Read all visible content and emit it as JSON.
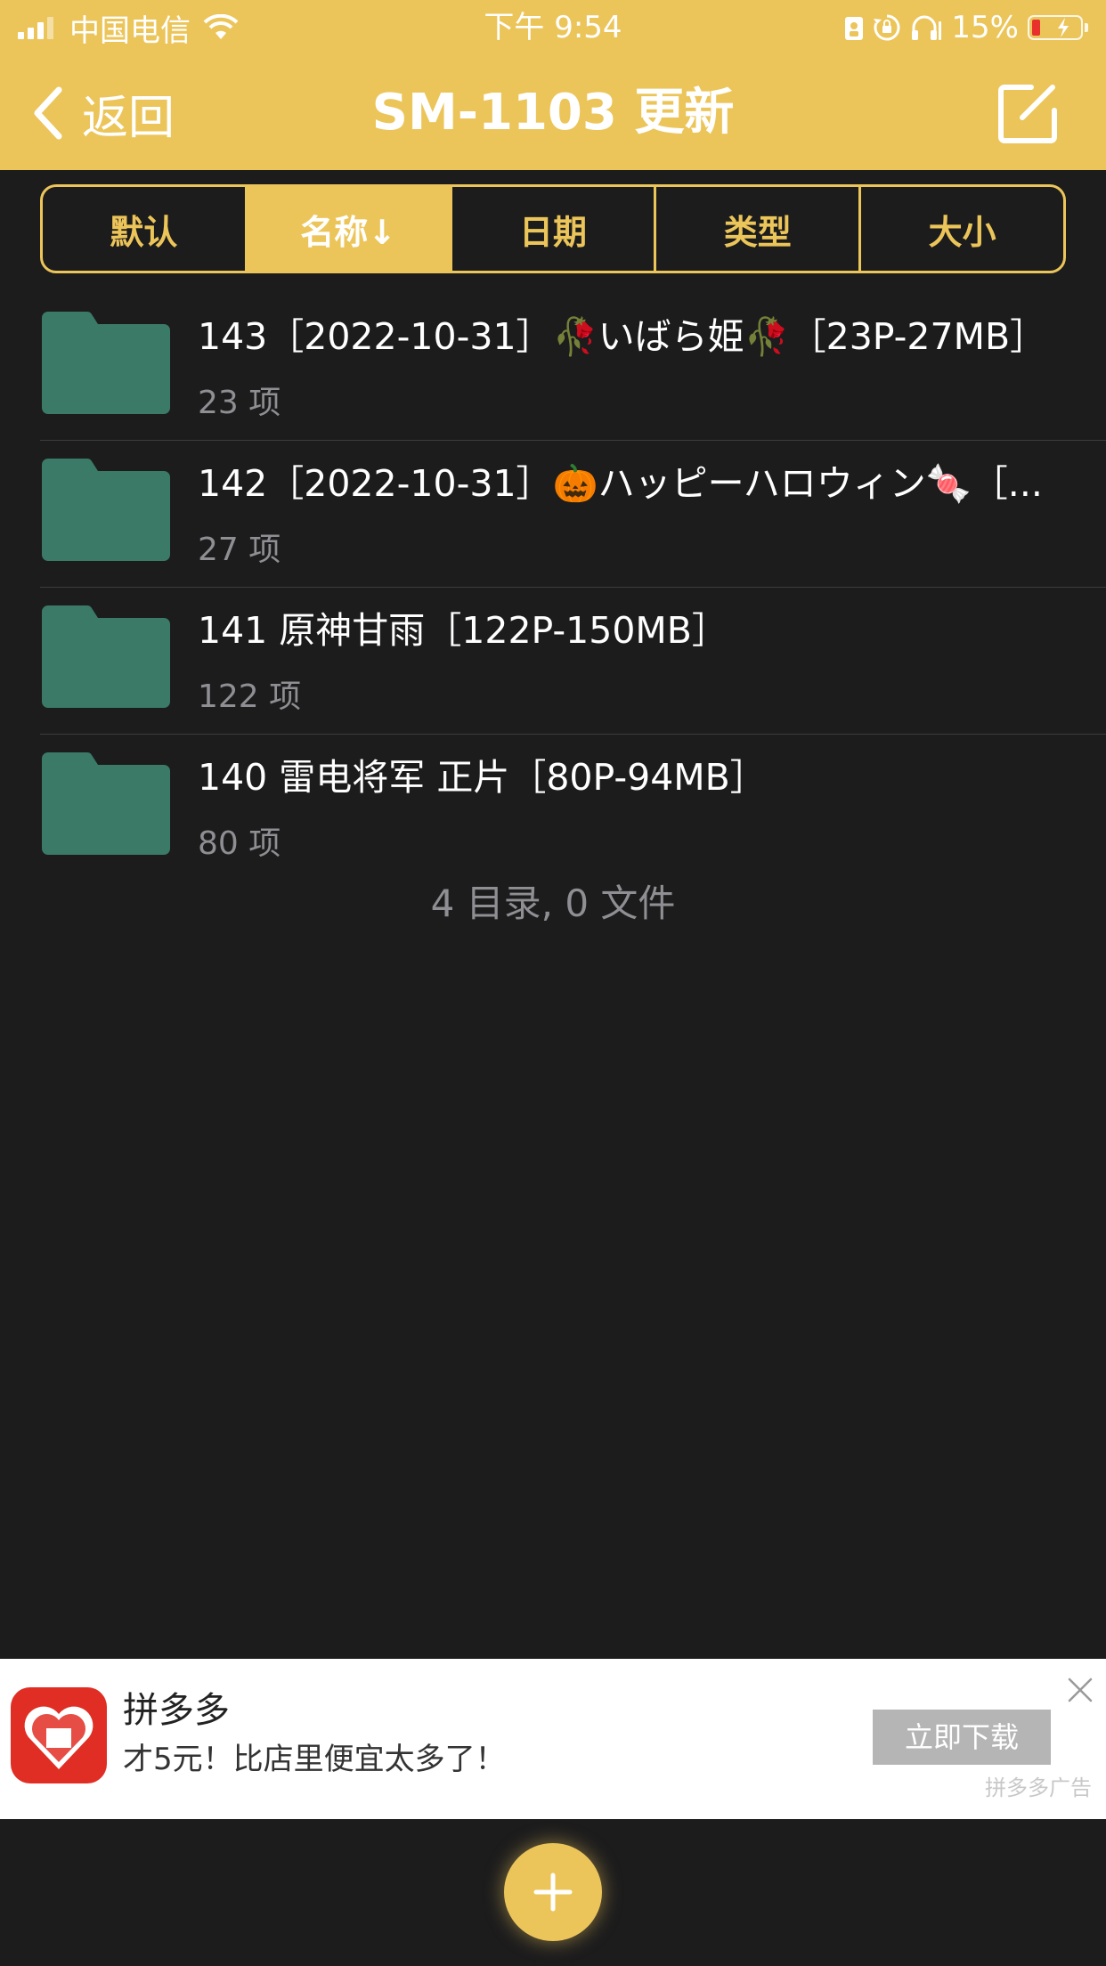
{
  "status_bar": {
    "carrier": "中国电信",
    "time": "下午 9:54",
    "battery_percent": "15%",
    "battery_level": 0.15
  },
  "nav": {
    "back_label": "返回",
    "title": "SM-1103 更新"
  },
  "sort_tabs": [
    {
      "label": "默认",
      "active": false
    },
    {
      "label": "名称↓",
      "active": true
    },
    {
      "label": "日期",
      "active": false
    },
    {
      "label": "类型",
      "active": false
    },
    {
      "label": "大小",
      "active": false
    }
  ],
  "folders": [
    {
      "name": "143［2022-10-31］🥀いばら姫🥀［23P-27MB］",
      "count": "23  项"
    },
    {
      "name": "142［2022-10-31］🎃ハッピーハロウィン🍬［...",
      "count": "27  项"
    },
    {
      "name": "141  原神甘雨［122P-150MB］",
      "count": "122  项"
    },
    {
      "name": "140  雷电将军 正片［80P-94MB］",
      "count": "80  项"
    }
  ],
  "summary": "4 目录, 0 文件",
  "ad": {
    "app_name": "拼多多",
    "description": "才5元！比店里便宜太多了！",
    "button_label": "立即下载",
    "label": "拼多多广告",
    "logo_text": "拼"
  },
  "colors": {
    "accent": "#ecc55a",
    "background": "#1c1c1d",
    "folder": "#3a7a66",
    "ad_brand": "#e02e24"
  },
  "icons": [
    "signal-icon",
    "wifi-icon",
    "lock-icon",
    "rotation-lock-icon",
    "headphones-icon",
    "battery-icon",
    "chevron-left-icon",
    "edit-icon",
    "folder-icon",
    "close-icon",
    "plus-icon"
  ]
}
